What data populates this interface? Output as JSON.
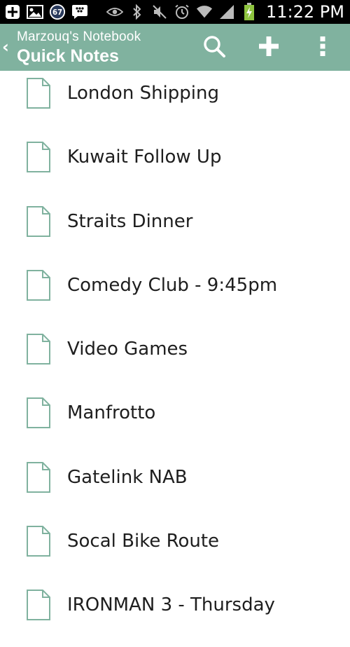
{
  "status_bar": {
    "time": "11:22 PM",
    "notification_count": "67",
    "icons": [
      "add-icon",
      "image-icon",
      "notification-count-icon",
      "bbm-icon",
      "eye-icon",
      "bluetooth-icon",
      "mute-icon",
      "alarm-icon",
      "wifi-icon",
      "signal-icon",
      "battery-charging-icon"
    ]
  },
  "action_bar": {
    "notebook_name": "Marzouq's Notebook",
    "section_title": "Quick Notes",
    "background_color": "#80b29f",
    "actions": [
      "search-icon",
      "add-icon",
      "overflow-menu-icon"
    ]
  },
  "notes": [
    {
      "title": "London Shipping"
    },
    {
      "title": "Kuwait Follow Up"
    },
    {
      "title": "Straits Dinner"
    },
    {
      "title": "Comedy Club - 9:45pm"
    },
    {
      "title": "Video Games"
    },
    {
      "title": "Manfrotto"
    },
    {
      "title": "Gatelink NAB"
    },
    {
      "title": "Socal Bike Route"
    },
    {
      "title": "IRONMAN 3 - Thursday"
    }
  ],
  "icon_color": "#80b29f"
}
